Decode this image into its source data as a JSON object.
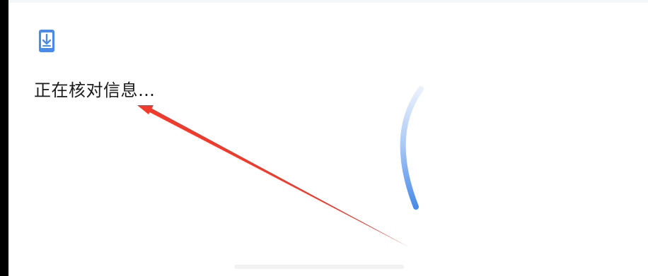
{
  "dialog": {
    "status_text": "正在核对信息…",
    "icon": "phone-download-icon"
  },
  "loading": {
    "indicator": "spinner-arc"
  },
  "annotation": {
    "arrow_icon": "red-arrow",
    "color": "#f03a2b"
  },
  "colors": {
    "accent": "#4a8bea",
    "text": "#1b1b1b",
    "background": "#ffffff"
  }
}
